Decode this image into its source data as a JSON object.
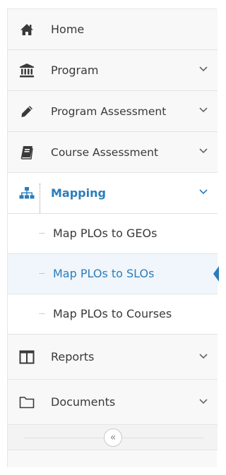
{
  "nav": {
    "home": "Home",
    "program": "Program",
    "program_assessment": "Program Assessment",
    "course_assessment": "Course Assessment",
    "mapping": "Mapping",
    "mapping_items": [
      "Map PLOs to GEOs",
      "Map PLOs to SLOs",
      "Map PLOs to Courses"
    ],
    "selected_mapping_item": "Map PLOs to SLOs",
    "reports": "Reports",
    "documents": "Documents"
  },
  "collapse_button": {
    "icon": "double-chevron-left-icon",
    "glyph": "«"
  },
  "colors": {
    "accent": "#2b7dbc",
    "text": "#393939",
    "sidebar_bg": "#f8f8f8"
  }
}
